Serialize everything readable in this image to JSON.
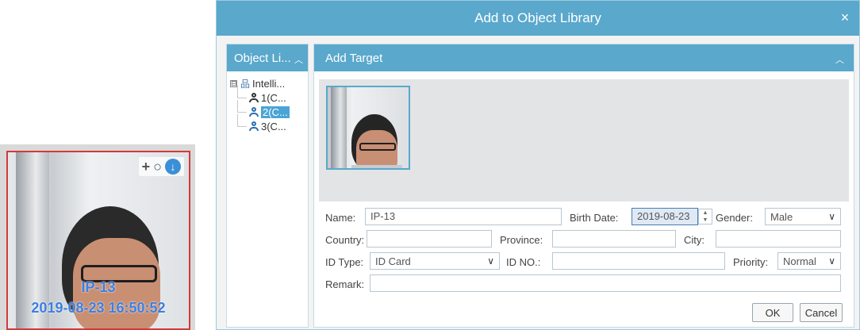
{
  "snapshot": {
    "overlay_name": "IP-13",
    "overlay_time": "2019-08-23 16:50:52",
    "icons": [
      "plus-icon",
      "search-icon",
      "download-icon"
    ]
  },
  "dialog": {
    "title": "Add to Object Library",
    "close_icon": "×"
  },
  "object_library": {
    "header": "Object Li...",
    "tree": {
      "root": {
        "expander": "⊟",
        "label": "Intelli..."
      },
      "children": [
        {
          "label": "1(C...",
          "selected": false
        },
        {
          "label": "2(C...",
          "selected": true
        },
        {
          "label": "3(C...",
          "selected": false
        }
      ]
    }
  },
  "add_target": {
    "header": "Add Target",
    "form": {
      "name_label": "Name:",
      "name_value": "IP-13",
      "birth_label": "Birth Date:",
      "birth_value": "2019-08-23",
      "gender_label": "Gender:",
      "gender_value": "Male",
      "country_label": "Country:",
      "country_value": "",
      "province_label": "Province:",
      "province_value": "",
      "city_label": "City:",
      "city_value": "",
      "idtype_label": "ID Type:",
      "idtype_value": "ID Card",
      "idno_label": "ID NO.:",
      "idno_value": "",
      "priority_label": "Priority:",
      "priority_value": "Normal",
      "remark_label": "Remark:",
      "remark_value": ""
    },
    "buttons": {
      "ok": "OK",
      "cancel": "Cancel"
    }
  },
  "colors": {
    "header_blue": "#5aa8cc",
    "selection_blue": "#4aa4d6",
    "snapshot_border": "#d23a3a",
    "overlay_text": "#3c7fe0"
  }
}
